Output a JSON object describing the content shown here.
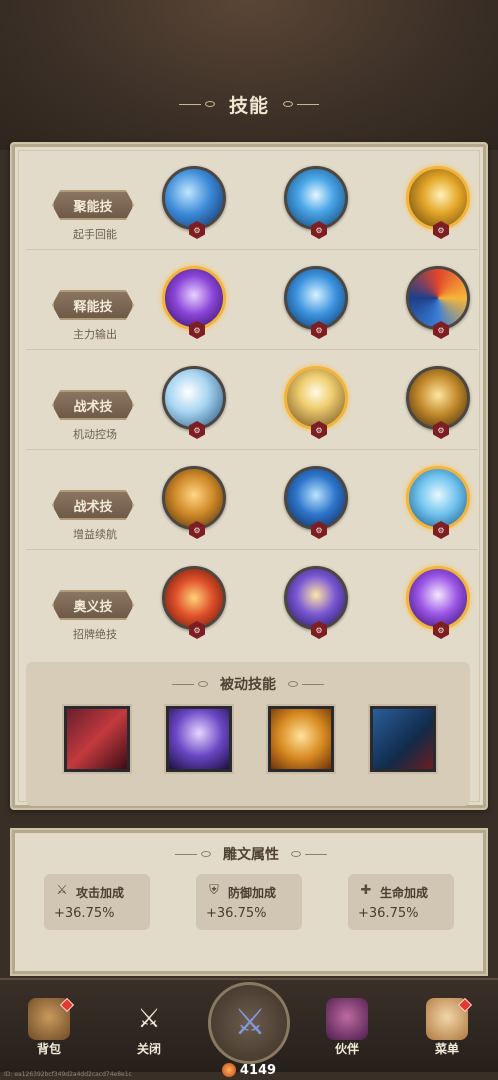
{
  "header": {
    "title": "技能"
  },
  "skill_rows": [
    {
      "label": "聚能技",
      "sub": "起手回能",
      "skills": [
        {
          "icon": "water-slash-icon",
          "gold": false
        },
        {
          "icon": "water-wave-icon",
          "gold": false
        },
        {
          "icon": "golden-blade-icon",
          "gold": true
        }
      ]
    },
    {
      "label": "释能技",
      "sub": "主力输出",
      "skills": [
        {
          "icon": "arcane-sword-icon",
          "gold": true
        },
        {
          "icon": "ice-shards-icon",
          "gold": false
        },
        {
          "icon": "elemental-vortex-icon",
          "gold": false
        }
      ]
    },
    {
      "label": "战术技",
      "sub": "机动控场",
      "skills": [
        {
          "icon": "wind-arc-icon",
          "gold": false
        },
        {
          "icon": "light-burst-icon",
          "gold": true
        },
        {
          "icon": "golden-dash-icon",
          "gold": false
        }
      ]
    },
    {
      "label": "战术技",
      "sub": "增益续航",
      "skills": [
        {
          "icon": "tiger-roar-icon",
          "gold": false
        },
        {
          "icon": "frost-tiger-icon",
          "gold": false
        },
        {
          "icon": "spirit-shield-icon",
          "gold": true
        }
      ]
    },
    {
      "label": "奥义技",
      "sub": "招牌绝技",
      "skills": [
        {
          "icon": "flame-warrior-icon",
          "gold": false
        },
        {
          "icon": "arcane-titan-icon",
          "gold": false
        },
        {
          "icon": "violet-strike-icon",
          "gold": true
        }
      ]
    }
  ],
  "passive": {
    "title": "被动技能",
    "icons": [
      "claw-rend-icon",
      "sage-tome-icon",
      "shield-hammer-icon",
      "shadow-wolf-icon"
    ]
  },
  "runes": {
    "title": "雕文属性",
    "stats": [
      {
        "name": "攻击加成",
        "value": "+36.75%",
        "icon": "sword-icon"
      },
      {
        "name": "防御加成",
        "value": "+36.75%",
        "icon": "shield-icon"
      },
      {
        "name": "生命加成",
        "value": "+36.75%",
        "icon": "heart-plus-icon"
      }
    ]
  },
  "nav": {
    "items": [
      {
        "label": "背包",
        "icon": "backpack-icon",
        "red_dot": true
      },
      {
        "label": "关闭",
        "icon": "crossed-swords-icon",
        "red_dot": false
      },
      {
        "label": "伙伴",
        "icon": "winged-helm-icon",
        "red_dot": false
      },
      {
        "label": "菜单",
        "icon": "scroll-menu-icon",
        "red_dot": true
      }
    ],
    "center_counter": "4149"
  },
  "build_id": "ID: ea126392bcf349d2a4dd2cacd74e8e1c"
}
